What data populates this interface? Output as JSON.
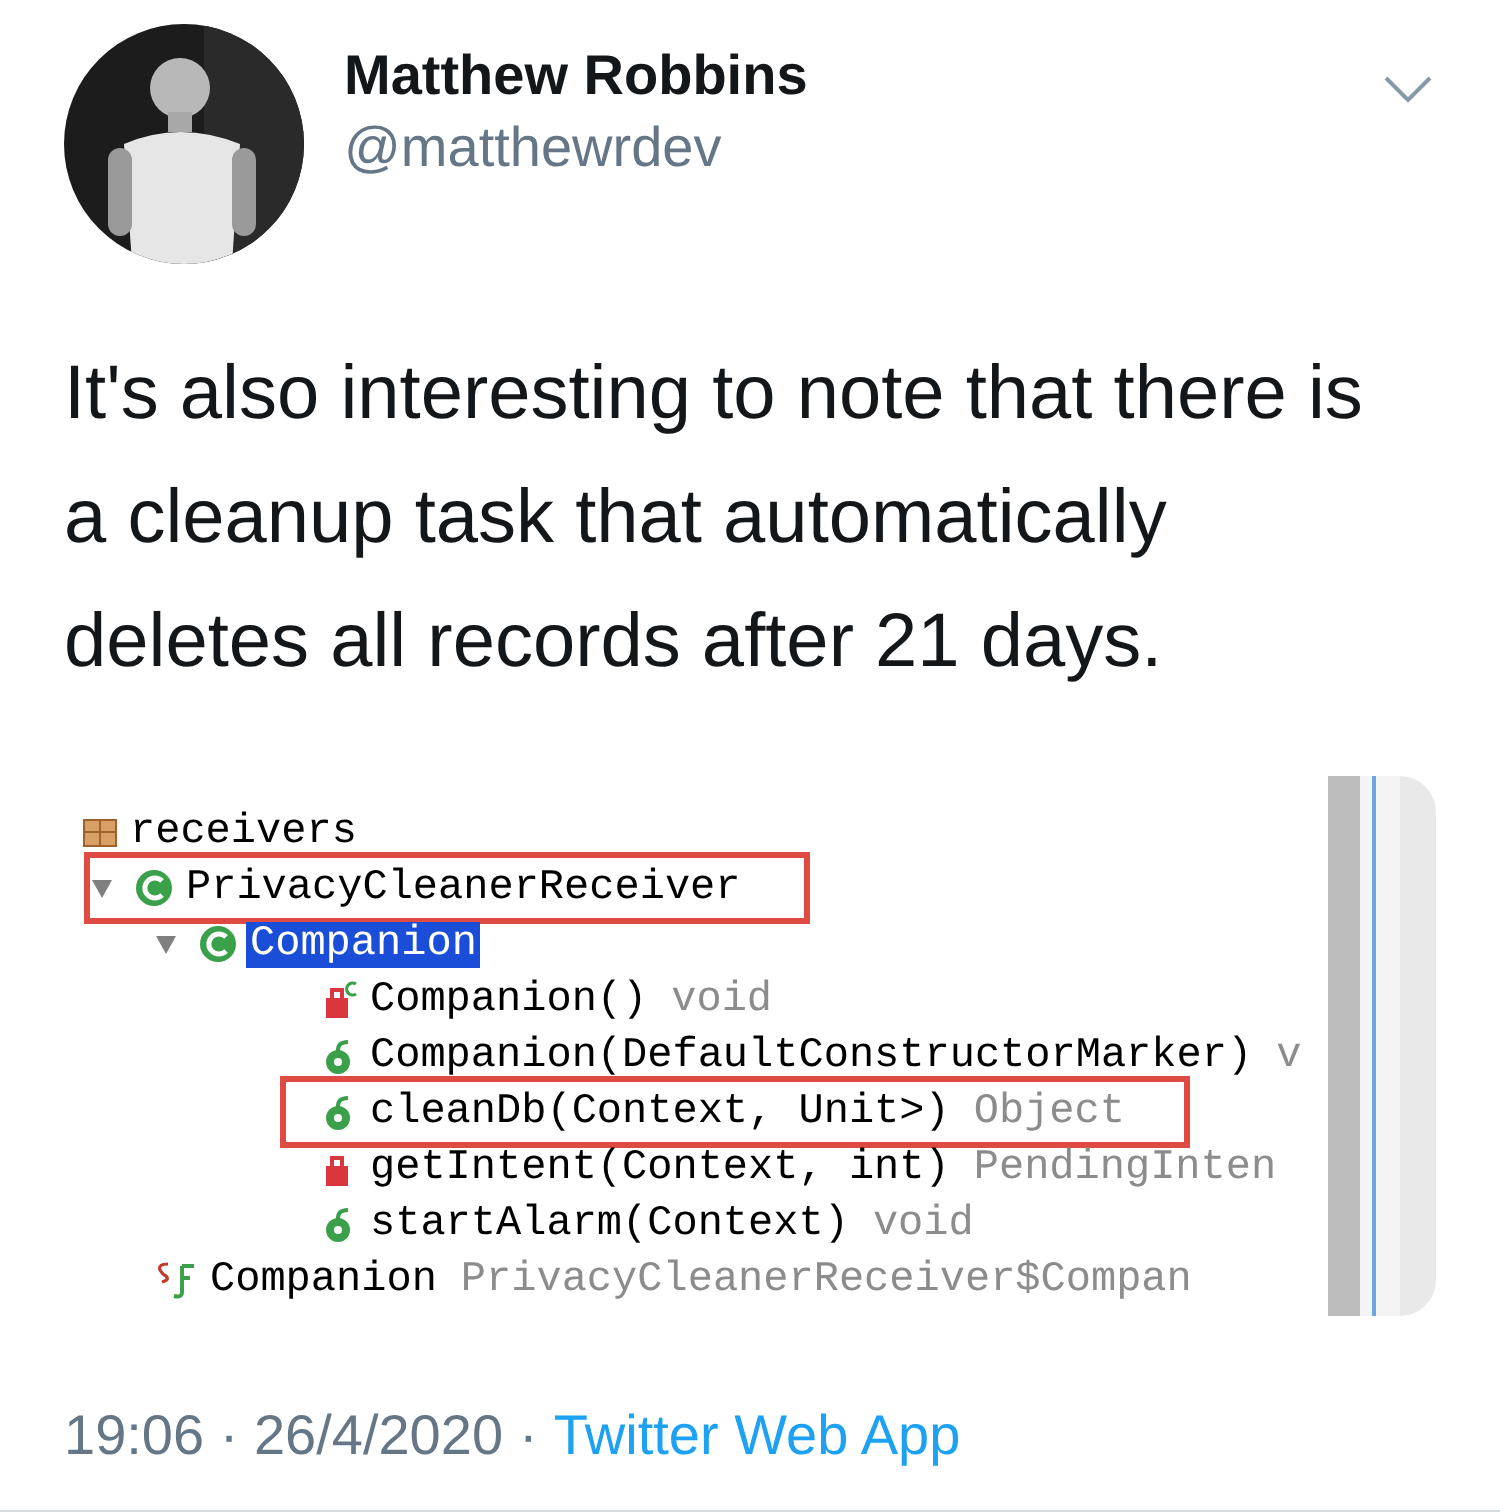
{
  "author": {
    "name": "Matthew Robbins",
    "handle": "@matthewrdev"
  },
  "tweet": {
    "text": "It's also interesting to note that there is a cleanup task that automatically deletes all records after 21 days."
  },
  "code_tree": {
    "items": [
      {
        "kind": "package",
        "label": "receivers",
        "selected": false,
        "highlighted": false,
        "children": [
          {
            "kind": "class",
            "label": "PrivacyCleanerReceiver",
            "expanded": true,
            "selected": false,
            "highlighted": true,
            "children": [
              {
                "kind": "class",
                "label": "Companion",
                "expanded": true,
                "selected": true,
                "highlighted": false,
                "children": [
                  {
                    "kind": "constructor-private",
                    "label": "Companion()",
                    "type": "void",
                    "selected": false,
                    "highlighted": false
                  },
                  {
                    "kind": "constructor",
                    "label": "Companion(DefaultConstructorMarker)",
                    "type": "v",
                    "selected": false,
                    "highlighted": false
                  },
                  {
                    "kind": "method",
                    "label": "cleanDb(Context, Unit>)",
                    "type": "Object",
                    "selected": false,
                    "highlighted": true
                  },
                  {
                    "kind": "method-private",
                    "label": "getIntent(Context, int)",
                    "type": "PendingInten",
                    "selected": false,
                    "highlighted": false
                  },
                  {
                    "kind": "method",
                    "label": "startAlarm(Context)",
                    "type": "void",
                    "selected": false,
                    "highlighted": false
                  }
                ]
              },
              {
                "kind": "static-field",
                "label": "Companion",
                "type": "PrivacyCleanerReceiver$Compan",
                "selected": false,
                "highlighted": false
              }
            ]
          }
        ]
      }
    ]
  },
  "footer": {
    "timestamp": "19:06 · 26/4/2020",
    "separator": "·",
    "source": "Twitter Web App"
  }
}
